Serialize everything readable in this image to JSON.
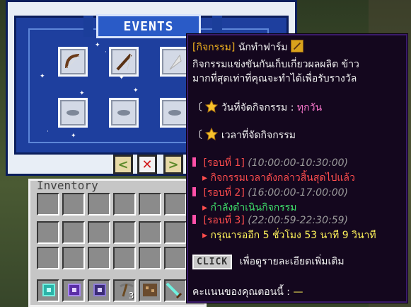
{
  "events_panel": {
    "banner": "EVENTS",
    "prev_label": "<",
    "close_label": "✕",
    "next_label": ">"
  },
  "inventory": {
    "title": "Inventory",
    "hotbar_count": "3"
  },
  "tooltip": {
    "title_tag": "[กิจกรรม]",
    "title_name": "นักทำฟาร์ม",
    "desc_line1": "กิจกรรมแข่งขันกันเก็บเกี่ยวผลผลิต ข้าว",
    "desc_line2": "มากที่สุดเท่าที่คุณจะทำได้เพื่อรับรางวัล",
    "day_open": "〔",
    "day_label": "วันที่จัดกิจกรรม :",
    "day_value": "ทุกวัน",
    "time_open": "〔",
    "time_label": "เวลาที่จัดกิจกรรม",
    "rounds": [
      {
        "label": "[รอบที่ 1]",
        "time": "(10:00:00-10:30:00)",
        "arrow": "▸",
        "status": "กิจกรรมเวลาดังกล่าวสิ้นสุดไปแล้ว"
      },
      {
        "label": "[รอบที่ 2]",
        "time": "(16:00:00-17:00:00)",
        "arrow": "▸",
        "status": "กำลังดำเนินกิจกรรม"
      },
      {
        "label": "[รอบที่ 3]",
        "time": "(22:00:59-22:30:59)",
        "arrow": "▸",
        "status": "กรุณารออีก 5 ชั่วโมง 53 นาที 9 วินาที"
      }
    ],
    "click_label": "CLICK",
    "click_text": "เพื่อดูรายละเอียดเพิ่มเติม",
    "score_label": "คะแนนของคุณตอนนี้ :",
    "score_value": "—"
  },
  "colors": {
    "tooltip_bg": "#14071e",
    "gold": "#f2b21e",
    "red": "#ff4d4d",
    "green": "#3fe06b",
    "yellow": "#fff35a",
    "pink": "#ff4fa7"
  }
}
